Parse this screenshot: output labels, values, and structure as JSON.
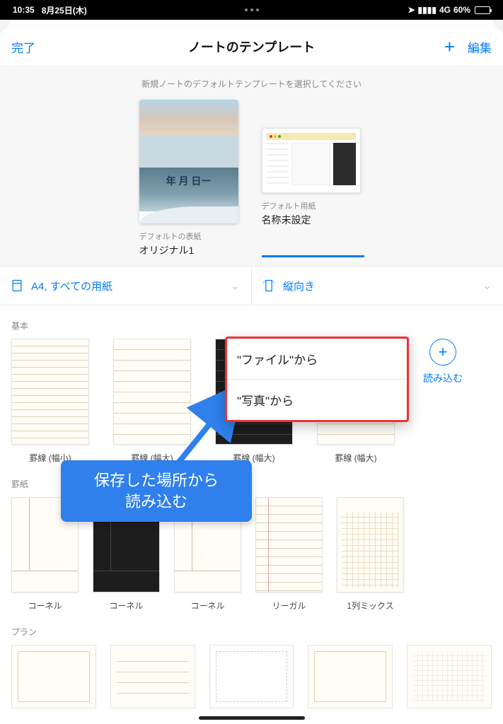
{
  "status": {
    "time": "10:35",
    "date": "8月25日(木)",
    "net_label": "4G",
    "net_pct": "60%"
  },
  "nav": {
    "done": "完了",
    "title": "ノートのテンプレート",
    "edit": "編集"
  },
  "selector": {
    "hint": "新規ノートのデフォルトテンプレートを選択してください",
    "cover_overlay": "年 月 日ー",
    "cover_sub": "デフォルトの表紙",
    "cover_main": "オリジナル1",
    "paper_sub": "デフォルト用紙",
    "paper_main": "名称未設定"
  },
  "filter": {
    "size": "A4, すべての用紙",
    "orient": "縦向き"
  },
  "sections": {
    "basic": "基本",
    "ruled": "罫紙",
    "plan": "プラン"
  },
  "basic_items": [
    "罫線 (幅小)",
    "罫線 (幅大)",
    "罫線 (幅大)",
    "罫線 (幅大)"
  ],
  "load": {
    "label": "読み込む"
  },
  "ruled_items": [
    "コーネル",
    "コーネル",
    "コーネル",
    "リーガル",
    "1列ミックス"
  ],
  "popup": {
    "from_file": "\"ファイル\"から",
    "from_photo": "\"写真\"から"
  },
  "annotation": {
    "line1": "保存した場所から",
    "line2": "読み込む"
  }
}
